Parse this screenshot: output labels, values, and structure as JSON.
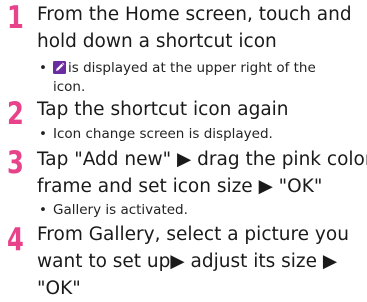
{
  "steps": [
    {
      "number": "1",
      "title_lines": [
        "From the Home screen, touch and",
        "hold down a shortcut icon"
      ],
      "note_lines": [
        "is displayed at the upper right of the",
        "icon."
      ],
      "note_icon": "edit-badge-icon"
    },
    {
      "number": "2",
      "title_lines": [
        "Tap the shortcut icon again"
      ],
      "note_lines": [
        "Icon change screen is displayed."
      ]
    },
    {
      "number": "3",
      "title_lines": [
        "Tap \"Add new\" ▶ drag the pink color",
        "frame and set icon size ▶ \"OK\""
      ],
      "note_lines": [
        "Gallery is activated."
      ]
    },
    {
      "number": "4",
      "title_lines": [
        "From Gallery, select a picture you",
        "want to set up▶ adjust its size ▶",
        "\"OK\""
      ]
    }
  ],
  "bullet": "•",
  "colors": {
    "step_number": "#e8428a",
    "icon_purple": "#6a2ca0",
    "icon_pen": "#ffffff"
  }
}
